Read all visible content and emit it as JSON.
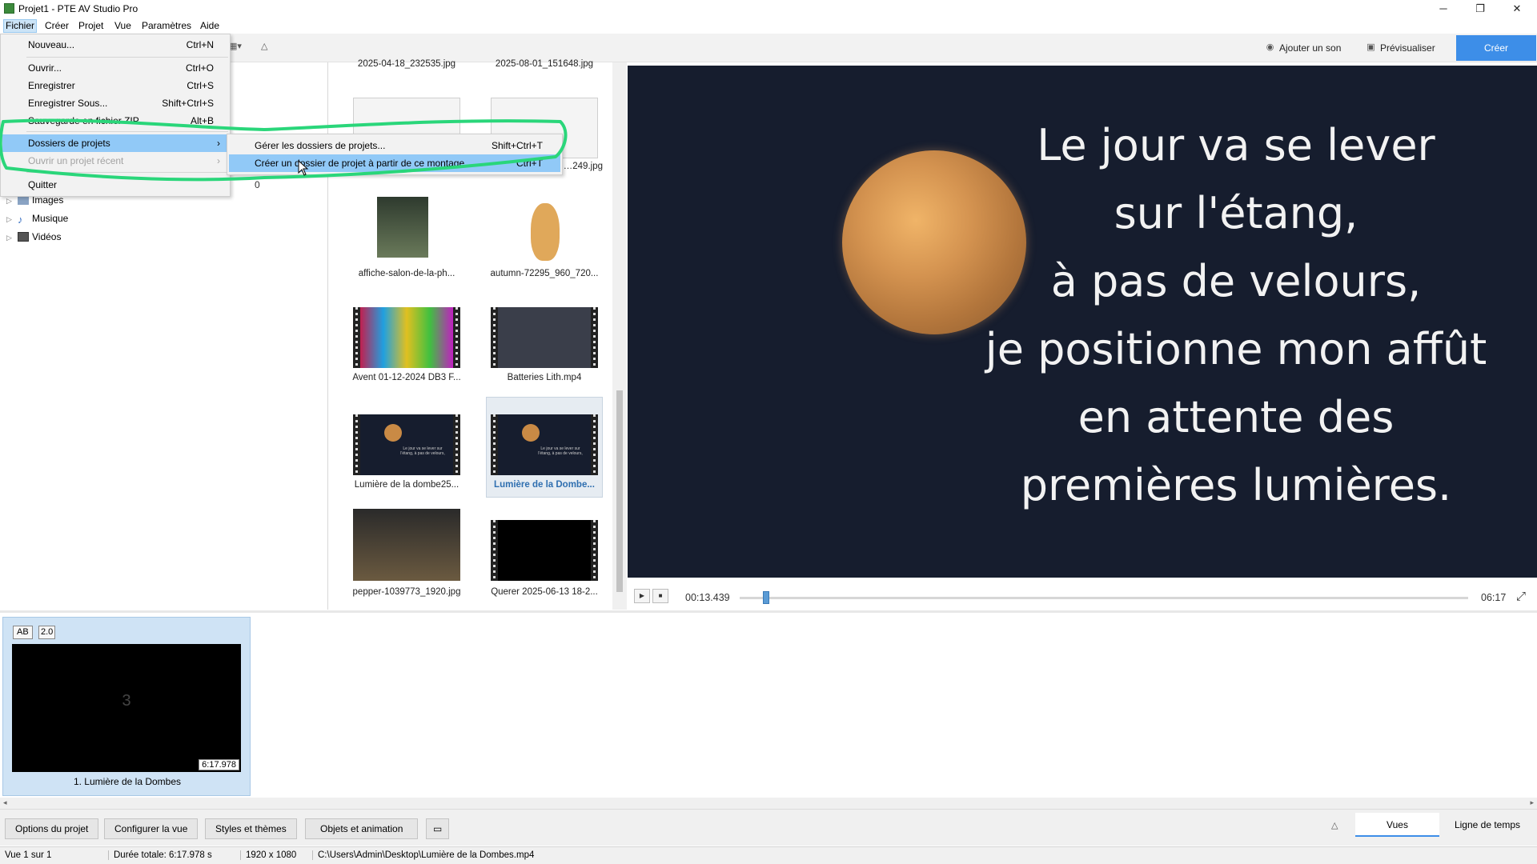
{
  "window": {
    "title": "Projet1 - PTE AV Studio Pro",
    "minimize": "─",
    "restore": "❐",
    "close": "✕"
  },
  "menubar": [
    "Fichier",
    "Créer",
    "Projet",
    "Vue",
    "Paramètres",
    "Aide"
  ],
  "toolbar": {
    "add_sound": "Ajouter un son",
    "preview": "Prévisualiser",
    "create": "Créer",
    "view_mode_icon": "▦▾",
    "collapse_icon": "△"
  },
  "tree": {
    "items": [
      {
        "label": "Images"
      },
      {
        "label": "Musique"
      },
      {
        "label": "Vidéos"
      }
    ],
    "partial_count": "0"
  },
  "thumbnails": [
    {
      "caption": "2025-04-18_232535.jpg"
    },
    {
      "caption": "2025-08-01_151648.jpg"
    },
    {
      "caption": "…249.jpg"
    },
    {
      "caption": "affiche-salon-de-la-ph..."
    },
    {
      "caption": "autumn-72295_960_720..."
    },
    {
      "caption": "Avent 01-12-2024 DB3 F..."
    },
    {
      "caption": "Batteries Lith.mp4"
    },
    {
      "caption": "Lumière de la dombe25..."
    },
    {
      "caption": "Lumière de la Dombe..."
    },
    {
      "caption": "pepper-1039773_1920.jpg"
    },
    {
      "caption": "Querer 2025-06-13 18-2..."
    }
  ],
  "thumb_overlay_text": "Le jour va se lever sur l'étang, à pas de velours,",
  "preview": {
    "lines": [
      "Le jour va se lever",
      "sur l'étang,",
      "à pas de velours,",
      "je positionne mon affût",
      "en attente des",
      "premières lumières."
    ]
  },
  "player": {
    "play": "▶",
    "stop": "■",
    "current_time": "00:13.439",
    "total_time": "06:17",
    "fullscreen": "⤢",
    "position_fraction": 0.036
  },
  "slide": {
    "tag_ab": "AB",
    "tag_duration": "2.0",
    "number": "3",
    "duration": "6:17.978",
    "title": "1. Lumière de la Dombes"
  },
  "bottom_buttons": [
    "Options du projet",
    "Configurer la vue",
    "Styles et thèmes",
    "Objets et animation"
  ],
  "view_tabs": {
    "views": "Vues",
    "timeline": "Ligne de temps"
  },
  "status": {
    "slide": "Vue 1 sur 1",
    "duration": "Durée totale: 6:17.978 s",
    "resolution": "1920 x 1080",
    "path": "C:\\Users\\Admin\\Desktop\\Lumière de la Dombes.mp4"
  },
  "file_menu": {
    "items": [
      {
        "label": "Nouveau...",
        "shortcut": "Ctrl+N"
      },
      {
        "label": "Ouvrir...",
        "shortcut": "Ctrl+O"
      },
      {
        "label": "Enregistrer",
        "shortcut": "Ctrl+S"
      },
      {
        "label": "Enregistrer Sous...",
        "shortcut": "Shift+Ctrl+S"
      },
      {
        "label": "Sauvegarde en fichier ZIP",
        "shortcut": "Alt+B"
      },
      {
        "label": "Dossiers de projets",
        "shortcut": "›"
      },
      {
        "label": "Ouvrir un projet récent",
        "shortcut": "›"
      },
      {
        "label": "Quitter",
        "shortcut": ""
      }
    ]
  },
  "submenu": {
    "items": [
      {
        "label": "Gérer les dossiers de projets...",
        "shortcut": "Shift+Ctrl+T"
      },
      {
        "label": "Créer un dossier de projet à partir de ce montage...",
        "shortcut": "Ctrl+T"
      }
    ]
  },
  "colors": {
    "accent": "#3d8ee8",
    "menu_highlight": "#91c9f7",
    "annotation_green": "#2ad67a",
    "preview_bg": "#161d2e"
  }
}
